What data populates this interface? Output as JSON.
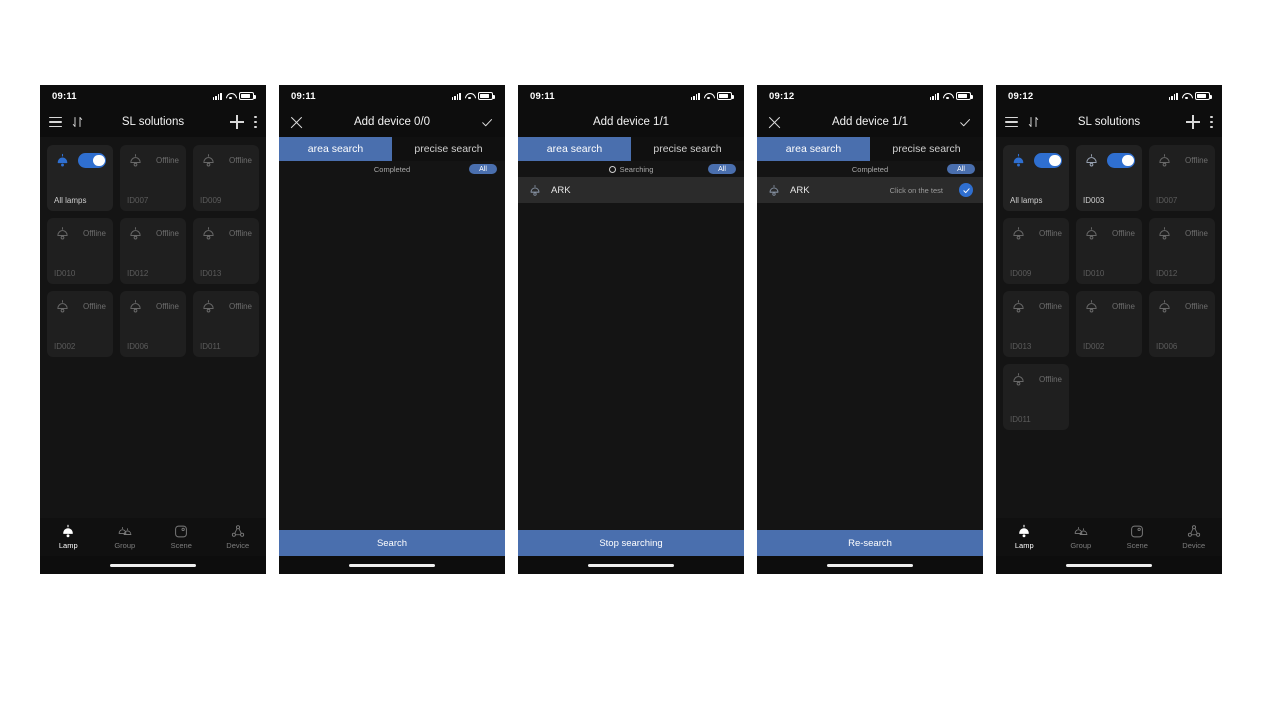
{
  "colors": {
    "accent_blue": "#4a6fae",
    "toggle_blue": "#2f6fd0",
    "app_background": "#141414",
    "bar_background": "#0d0d0d",
    "card_background": "#222222",
    "offline_text": "#6e6e6e"
  },
  "panels": [
    {
      "id": "lamp-list-before",
      "type": "lamp-list",
      "statusbar": {
        "time": "09:11",
        "signal": "signal-icon",
        "wifi": "wifi-icon",
        "battery": "battery-icon"
      },
      "header": {
        "menu_icon": "hamburger-icon",
        "sort_icon": "sort-icon",
        "title": "SL solutions",
        "add_icon": "plus-icon",
        "more_icon": "kebab-menu-icon"
      },
      "cards": [
        {
          "label": "All lamps",
          "state": "on",
          "status": "",
          "icon": "lamp-filled-icon"
        },
        {
          "label": "ID007",
          "state": "offline",
          "status": "Offline",
          "icon": "lamp-outline-icon"
        },
        {
          "label": "ID009",
          "state": "offline",
          "status": "Offline",
          "icon": "lamp-outline-icon"
        },
        {
          "label": "ID010",
          "state": "offline",
          "status": "Offline",
          "icon": "lamp-outline-icon"
        },
        {
          "label": "ID012",
          "state": "offline",
          "status": "Offline",
          "icon": "lamp-outline-icon"
        },
        {
          "label": "ID013",
          "state": "offline",
          "status": "Offline",
          "icon": "lamp-outline-icon"
        },
        {
          "label": "ID002",
          "state": "offline",
          "status": "Offline",
          "icon": "lamp-outline-icon"
        },
        {
          "label": "ID006",
          "state": "offline",
          "status": "Offline",
          "icon": "lamp-outline-icon"
        },
        {
          "label": "ID011",
          "state": "offline",
          "status": "Offline",
          "icon": "lamp-outline-icon"
        }
      ],
      "bottomnav": [
        {
          "label": "Lamp",
          "icon": "lamp-icon",
          "active": true
        },
        {
          "label": "Group",
          "icon": "group-icon",
          "active": false
        },
        {
          "label": "Scene",
          "icon": "scene-icon",
          "active": false
        },
        {
          "label": "Device",
          "icon": "device-icon",
          "active": false
        }
      ]
    },
    {
      "id": "add-device-idle",
      "type": "add-device",
      "statusbar": {
        "time": "09:11"
      },
      "header": {
        "close_icon": "close-icon",
        "title": "Add device 0/0",
        "confirm_icon": "check-icon",
        "show_icons": true
      },
      "tabs": [
        {
          "label": "area search",
          "active": true
        },
        {
          "label": "precise search",
          "active": false
        }
      ],
      "strip": {
        "status_text": "Completed",
        "spinner": false,
        "filter_label": "All"
      },
      "results": [],
      "action_button": "Search"
    },
    {
      "id": "add-device-searching",
      "type": "add-device",
      "statusbar": {
        "time": "09:11"
      },
      "header": {
        "close_icon": "close-icon",
        "title": "Add device 1/1",
        "confirm_icon": "check-icon",
        "show_icons": false
      },
      "tabs": [
        {
          "label": "area search",
          "active": true
        },
        {
          "label": "precise search",
          "active": false
        }
      ],
      "strip": {
        "status_text": "Searching",
        "spinner": true,
        "filter_label": "All"
      },
      "results": [
        {
          "name": "ARK",
          "icon": "lamp-outline-icon",
          "hint": "",
          "selected": false
        }
      ],
      "action_button": "Stop searching"
    },
    {
      "id": "add-device-found",
      "type": "add-device",
      "statusbar": {
        "time": "09:12"
      },
      "header": {
        "close_icon": "close-icon",
        "title": "Add device 1/1",
        "confirm_icon": "check-icon",
        "show_icons": true
      },
      "tabs": [
        {
          "label": "area search",
          "active": true
        },
        {
          "label": "precise search",
          "active": false
        }
      ],
      "strip": {
        "status_text": "Completed",
        "spinner": false,
        "filter_label": "All"
      },
      "results": [
        {
          "name": "ARK",
          "icon": "lamp-outline-icon",
          "hint": "Click on the test",
          "selected": true
        }
      ],
      "action_button": "Re-search"
    },
    {
      "id": "lamp-list-after",
      "type": "lamp-list",
      "statusbar": {
        "time": "09:12"
      },
      "header": {
        "menu_icon": "hamburger-icon",
        "sort_icon": "sort-icon",
        "title": "SL solutions",
        "add_icon": "plus-icon",
        "more_icon": "kebab-menu-icon"
      },
      "cards": [
        {
          "label": "All lamps",
          "state": "on",
          "status": "",
          "icon": "lamp-filled-icon"
        },
        {
          "label": "ID003",
          "state": "on",
          "status": "",
          "icon": "lamp-outline-icon"
        },
        {
          "label": "ID007",
          "state": "offline",
          "status": "Offline",
          "icon": "lamp-outline-icon"
        },
        {
          "label": "ID009",
          "state": "offline",
          "status": "Offline",
          "icon": "lamp-outline-icon"
        },
        {
          "label": "ID010",
          "state": "offline",
          "status": "Offline",
          "icon": "lamp-outline-icon"
        },
        {
          "label": "ID012",
          "state": "offline",
          "status": "Offline",
          "icon": "lamp-outline-icon"
        },
        {
          "label": "ID013",
          "state": "offline",
          "status": "Offline",
          "icon": "lamp-outline-icon"
        },
        {
          "label": "ID002",
          "state": "offline",
          "status": "Offline",
          "icon": "lamp-outline-icon"
        },
        {
          "label": "ID006",
          "state": "offline",
          "status": "Offline",
          "icon": "lamp-outline-icon"
        },
        {
          "label": "ID011",
          "state": "offline",
          "status": "Offline",
          "icon": "lamp-outline-icon"
        }
      ],
      "bottomnav": [
        {
          "label": "Lamp",
          "icon": "lamp-icon",
          "active": true
        },
        {
          "label": "Group",
          "icon": "group-icon",
          "active": false
        },
        {
          "label": "Scene",
          "icon": "scene-icon",
          "active": false
        },
        {
          "label": "Device",
          "icon": "device-icon",
          "active": false
        }
      ]
    }
  ]
}
